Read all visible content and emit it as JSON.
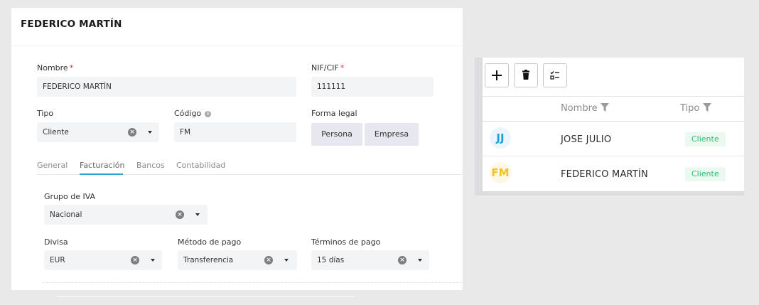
{
  "form": {
    "title": "FEDERICO MARTÍN",
    "nombre": {
      "label": "Nombre",
      "required": "*",
      "value": "FEDERICO MARTÍN"
    },
    "nif": {
      "label": "NIF/CIF",
      "required": "*",
      "value": "111111"
    },
    "tipo": {
      "label": "Tipo",
      "value": "Cliente"
    },
    "codigo": {
      "label": "Código",
      "info": "i",
      "value": "FM"
    },
    "forma_legal": {
      "label": "Forma legal",
      "options": [
        "Persona",
        "Empresa"
      ]
    },
    "tabs": [
      {
        "label": "General"
      },
      {
        "label": "Facturación",
        "active": true
      },
      {
        "label": "Bancos"
      },
      {
        "label": "Contabilidad"
      }
    ],
    "grupo_iva": {
      "label": "Grupo de IVA",
      "value": "Nacional"
    },
    "divisa": {
      "label": "Divisa",
      "value": "EUR"
    },
    "metodo_pago": {
      "label": "Método de pago",
      "value": "Transferencia"
    },
    "terminos_pago": {
      "label": "Términos de pago",
      "value": "15 días"
    }
  },
  "list": {
    "toolbar": [
      {
        "name": "add",
        "icon": "plus-icon"
      },
      {
        "name": "delete",
        "icon": "trash-icon"
      },
      {
        "name": "select",
        "icon": "checklist-icon"
      }
    ],
    "columns": {
      "nombre": "Nombre",
      "tipo": "Tipo"
    },
    "rows": [
      {
        "initials": "JJ",
        "name": "JOSE JULIO",
        "tipo": "Cliente",
        "avatar_color": "#1e9fd8",
        "avatar_bg": "#eaf6fc"
      },
      {
        "initials": "FM",
        "name": "FEDERICO MARTÍN",
        "tipo": "Cliente",
        "avatar_color": "#f2c31b",
        "avatar_bg": "#fdf8e6"
      }
    ]
  }
}
